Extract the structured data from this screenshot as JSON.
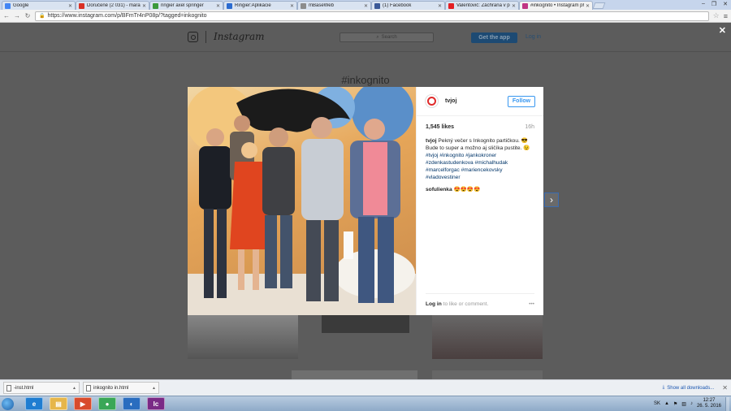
{
  "browser": {
    "tabs": [
      {
        "title": "Google",
        "favicon_color": "#4285f4"
      },
      {
        "title": "Doručené (2 031) - mara",
        "favicon_color": "#d93025"
      },
      {
        "title": "ringier axel springer",
        "favicon_color": "#3c9a3c"
      },
      {
        "title": "Ringier:Aplikácie",
        "favicon_color": "#2b6bd0"
      },
      {
        "title": "mBaseWeb",
        "favicon_color": "#8c8c8c"
      },
      {
        "title": "(1) Facebook",
        "favicon_color": "#3b5998"
      },
      {
        "title": "Valentovič: Záchrana v poc",
        "favicon_color": "#e31e24"
      },
      {
        "title": "#inkognito • Instagram ph",
        "favicon_color": "#c13584"
      }
    ],
    "active_tab_index": 7,
    "url": "https://www.instagram.com/p/BFmTr4nP08p/?tagged=inkognito",
    "icons": {
      "back": "back-arrow-icon",
      "forward": "forward-arrow-icon",
      "reload": "reload-icon",
      "bookmark": "star-icon",
      "menu": "menu-icon"
    }
  },
  "instagram": {
    "wordmark": "Instagram",
    "search_placeholder": "Search",
    "get_app": "Get the app",
    "login": "Log in",
    "hashtag": "#inkognito"
  },
  "post": {
    "username": "tvjoj",
    "follow": "Follow",
    "likes": "1,545 likes",
    "time": "16h",
    "caption_user": "tvjoj",
    "caption_text": "Pekný večer s Inkognito partičkou. 😎 Bude to super a možno aj sličíka pustite. 😉",
    "hashtags": "#tvjoj #inkognito #jankokroner #zdenkastudenkova #michalhudak #marcelforgac #mariencekovsky #vladovestiner",
    "comment_user": "sofulienka",
    "comment_text": "😍😍😍😍",
    "login_prompt_link": "Log in",
    "login_prompt_rest": " to like or comment.",
    "more": "•••"
  },
  "downloads": {
    "items": [
      {
        "name": "-inst.html"
      },
      {
        "name": "inkognito in.html"
      }
    ],
    "show_all": "Show all downloads..."
  },
  "taskbar": {
    "apps": [
      {
        "name": "ie",
        "label": "e",
        "color": "#1f7dd1"
      },
      {
        "name": "explorer",
        "label": "▤",
        "color": "#e6b64a"
      },
      {
        "name": "media",
        "label": "▶",
        "color": "#d84b2c"
      },
      {
        "name": "chrome",
        "label": "●",
        "color": "#3aa757"
      },
      {
        "name": "remote",
        "label": "◐",
        "color": "#2a6dbf"
      },
      {
        "name": "incopy",
        "label": "Ic",
        "color": "#7a2a86"
      }
    ],
    "lang": "SK",
    "time": "12:27",
    "date": "26. 5. 2016"
  }
}
